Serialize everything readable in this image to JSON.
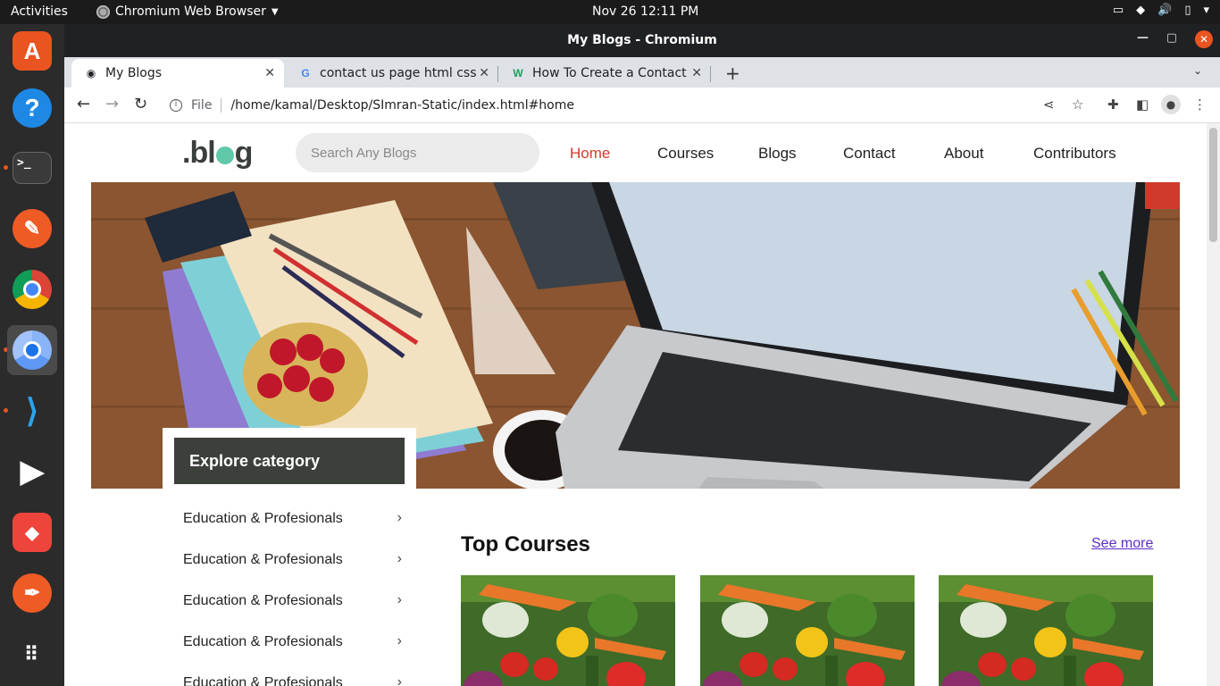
{
  "topbar": {
    "activities": "Activities",
    "app_name": "Chromium Web Browser",
    "clock": "Nov 26  12:11 PM"
  },
  "dock": {
    "items": [
      "Ubuntu Software",
      "Help",
      "Terminal",
      "Postman",
      "Google Chrome",
      "Chromium",
      "Visual Studio Code",
      "Media Player",
      "AnyDesk",
      "Inkscape",
      "Show Applications"
    ]
  },
  "window": {
    "title": "My Blogs - Chromium"
  },
  "tabs": [
    {
      "label": "My Blogs",
      "active": true
    },
    {
      "label": "contact us page html css c",
      "active": false
    },
    {
      "label": "How To Create a Contact F",
      "active": false
    }
  ],
  "toolbar": {
    "scheme": "File",
    "url": "/home/kamal/Desktop/SImran-Static/index.html#home"
  },
  "site": {
    "logo": "blog",
    "search_placeholder": "Search Any Blogs",
    "menu": [
      "Home",
      "Courses",
      "Blogs",
      "Contact",
      "About",
      "Contributors"
    ],
    "active_menu": "Home"
  },
  "categories": {
    "heading": "Explore category",
    "items": [
      "Education & Profesionals",
      "Education & Profesionals",
      "Education & Profesionals",
      "Education & Profesionals",
      "Education & Profesionals"
    ]
  },
  "courses": {
    "title": "Top Courses",
    "see_more": "See more"
  },
  "colors": {
    "accent_active": "#d33a2a",
    "category_head_bg": "#3c403b",
    "link": "#5a2dbf",
    "ubuntu_orange": "#e95420"
  }
}
